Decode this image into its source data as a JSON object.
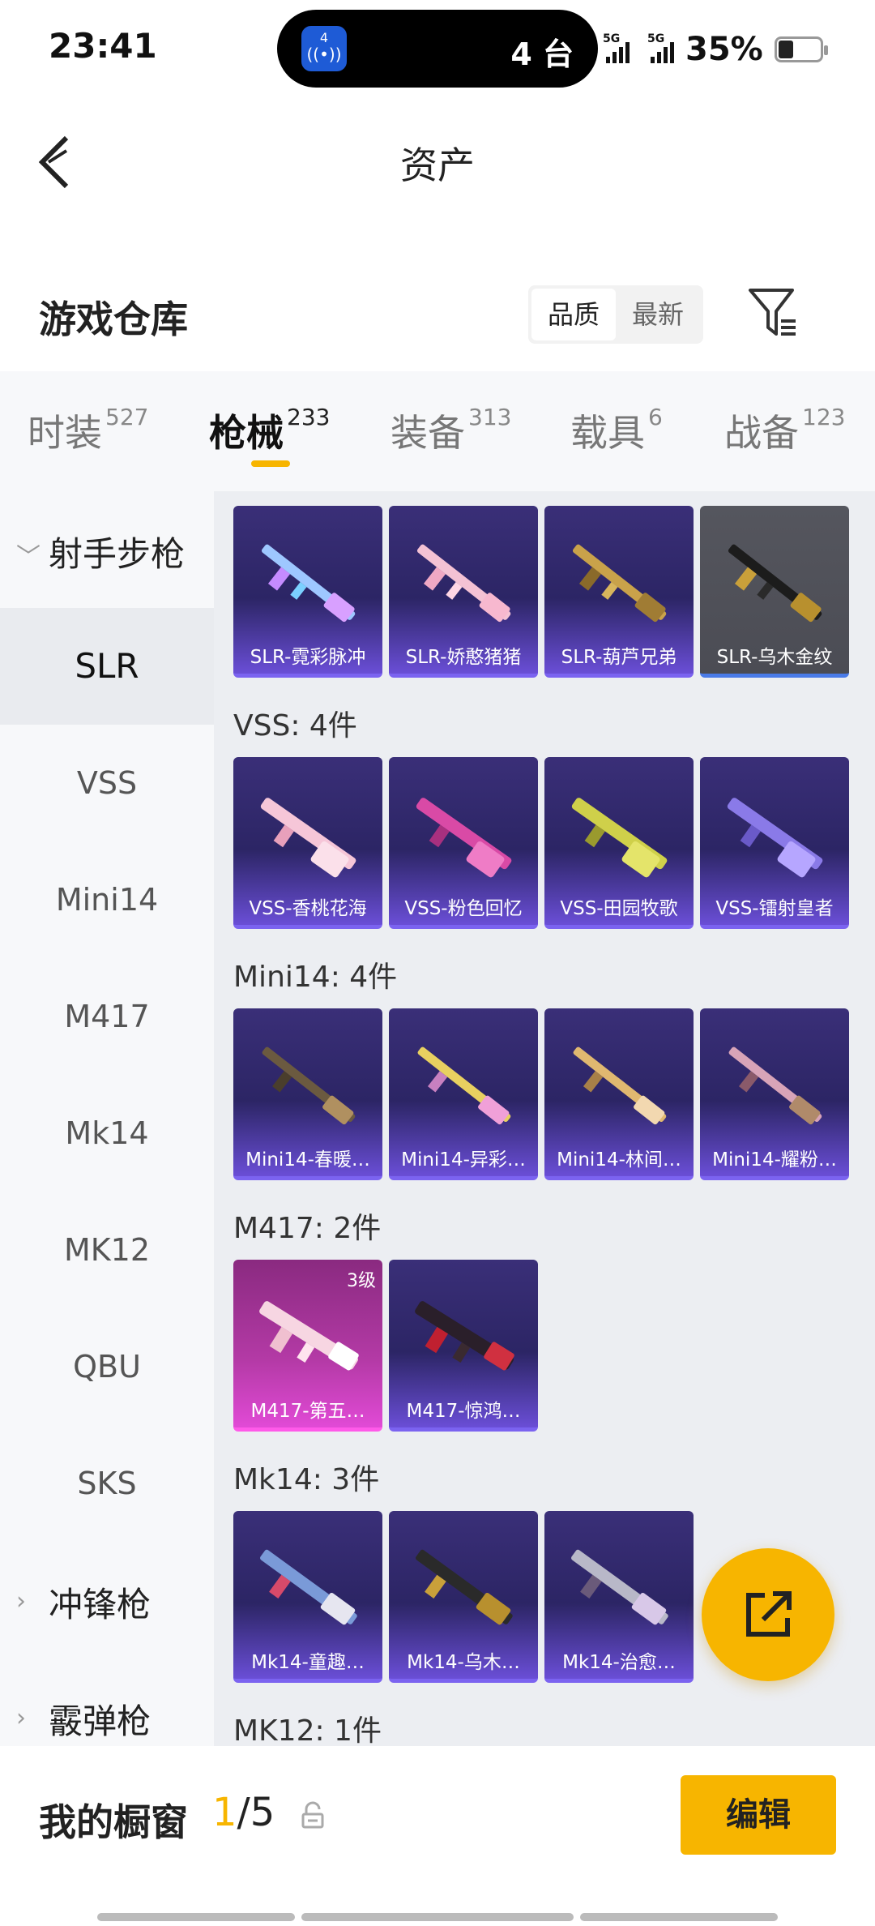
{
  "status_bar": {
    "time": "23:41",
    "island_app_badge": "4",
    "island_text": "4 台",
    "signal1_label": "5G",
    "signal2_label": "5G",
    "battery": "35%",
    "battery_level": 0.35
  },
  "header": {
    "title": "资产",
    "back_icon": "chevron-left-icon"
  },
  "warehouse": {
    "title": "游戏仓库",
    "sort_options": [
      "品质",
      "最新"
    ],
    "sort_selected": "品质",
    "filter_icon": "filter-icon"
  },
  "tabs": [
    {
      "label": "时装",
      "count": "527"
    },
    {
      "label": "枪械",
      "count": "233"
    },
    {
      "label": "装备",
      "count": "313"
    },
    {
      "label": "载具",
      "count": "6"
    },
    {
      "label": "战备",
      "count": "123"
    }
  ],
  "active_tab": "枪械",
  "sidebar": {
    "groups": [
      {
        "label": "射手步枪",
        "expanded": true,
        "items": [
          "SLR",
          "VSS",
          "Mini14",
          "M417",
          "Mk14",
          "MK12",
          "QBU",
          "SKS"
        ]
      },
      {
        "label": "冲锋枪",
        "expanded": false
      },
      {
        "label": "霰弹枪",
        "expanded": false
      }
    ],
    "selected": "SLR"
  },
  "content": {
    "groups": [
      {
        "label": "",
        "items": [
          "SLR-霓彩脉冲",
          "SLR-娇憨猪猪",
          "SLR-葫芦兄弟",
          "SLR-乌木金纹"
        ]
      },
      {
        "label": "VSS: 4件",
        "items": [
          "VSS-香桃花海",
          "VSS-粉色回忆",
          "VSS-田园牧歌",
          "VSS-镭射皇者"
        ]
      },
      {
        "label": "Mini14: 4件",
        "items": [
          "Mini14-春暖…",
          "Mini14-异彩…",
          "Mini14-林间…",
          "Mini14-耀粉…"
        ]
      },
      {
        "label": "M417: 2件",
        "items": [
          "M417-第五…",
          "M417-惊鸿…"
        ],
        "level_badge": "3级"
      },
      {
        "label": "Mk14: 3件",
        "items": [
          "Mk14-童趣…",
          "Mk14-乌木…",
          "Mk14-治愈…"
        ]
      },
      {
        "label": "MK12: 1件",
        "items": []
      }
    ]
  },
  "fab": {
    "icon": "share-external-icon"
  },
  "bottom": {
    "showcase_label": "我的橱窗",
    "showcase_current": "1",
    "showcase_total": "/5",
    "lock_icon": "lock-icon",
    "edit_label": "编辑"
  },
  "colors": {
    "accent": "#f7b500",
    "card_purple": "#3a2f78",
    "card_pink": "#b43aa6",
    "card_gray": "#4b4c54"
  }
}
